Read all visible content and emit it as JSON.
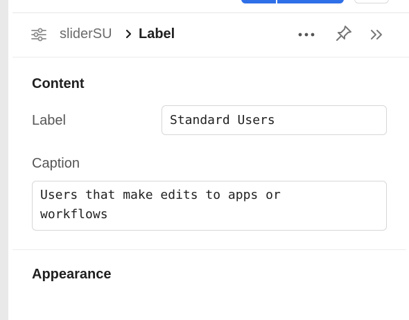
{
  "header": {
    "breadcrumb_parent": "sliderSU",
    "breadcrumb_current": "Label",
    "icons": {
      "component": "sliders-icon",
      "separator": "chevron-right-icon",
      "more": "more-horizontal-icon",
      "pin": "pin-icon",
      "collapse": "double-chevron-right-icon"
    }
  },
  "content": {
    "title": "Content",
    "label_field": {
      "label": "Label",
      "value": "Standard Users"
    },
    "caption_field": {
      "label": "Caption",
      "value": "Users that make edits to apps or\nworkflows"
    }
  },
  "appearance": {
    "title": "Appearance"
  },
  "colors": {
    "accent": "#2f6fe8",
    "rail": "#e9e9e9",
    "border": "#d7d7d7"
  }
}
